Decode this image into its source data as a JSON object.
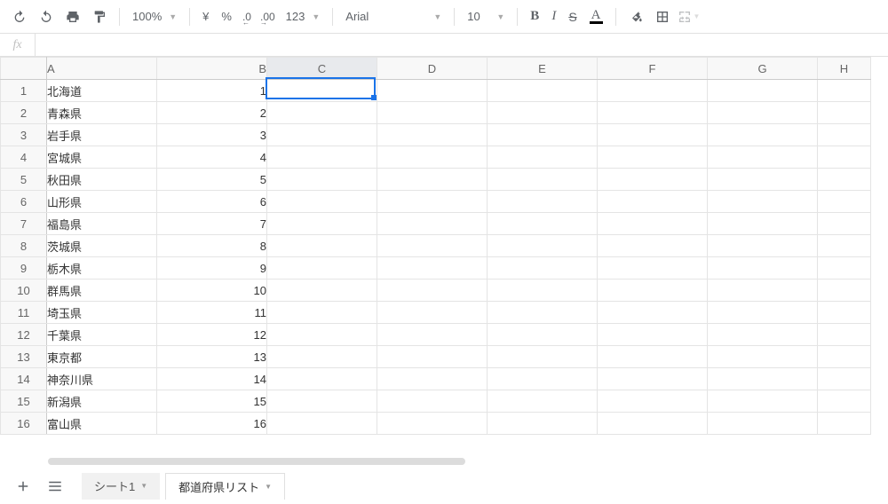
{
  "toolbar": {
    "zoom": "100%",
    "currency": "¥",
    "percent": "%",
    "decrease_dec": ".0",
    "increase_dec": ".00",
    "more_fmt": "123",
    "font": "Arial",
    "font_size": "10",
    "bold": "B",
    "italic": "I",
    "strike": "S",
    "text_color": "A"
  },
  "formula_bar": {
    "label": "fx",
    "value": ""
  },
  "grid": {
    "columns": [
      "A",
      "B",
      "C",
      "D",
      "E",
      "F",
      "G",
      "H"
    ],
    "selected_cell": "C1",
    "rows": [
      {
        "n": 1,
        "a": "北海道",
        "b": "1"
      },
      {
        "n": 2,
        "a": "青森県",
        "b": "2"
      },
      {
        "n": 3,
        "a": "岩手県",
        "b": "3"
      },
      {
        "n": 4,
        "a": "宮城県",
        "b": "4"
      },
      {
        "n": 5,
        "a": "秋田県",
        "b": "5"
      },
      {
        "n": 6,
        "a": "山形県",
        "b": "6"
      },
      {
        "n": 7,
        "a": "福島県",
        "b": "7"
      },
      {
        "n": 8,
        "a": "茨城県",
        "b": "8"
      },
      {
        "n": 9,
        "a": "栃木県",
        "b": "9"
      },
      {
        "n": 10,
        "a": "群馬県",
        "b": "10"
      },
      {
        "n": 11,
        "a": "埼玉県",
        "b": "11"
      },
      {
        "n": 12,
        "a": "千葉県",
        "b": "12"
      },
      {
        "n": 13,
        "a": "東京都",
        "b": "13"
      },
      {
        "n": 14,
        "a": "神奈川県",
        "b": "14"
      },
      {
        "n": 15,
        "a": "新潟県",
        "b": "15"
      },
      {
        "n": 16,
        "a": "富山県",
        "b": "16"
      }
    ]
  },
  "sheets": {
    "tabs": [
      {
        "label": "シート1",
        "active": false
      },
      {
        "label": "都道府県リスト",
        "active": true
      }
    ]
  }
}
